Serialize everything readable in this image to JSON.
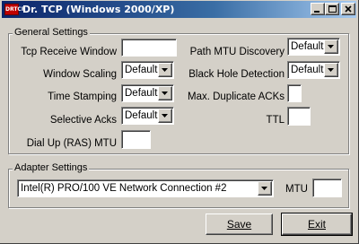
{
  "window": {
    "title": "Dr. TCP (Windows 2000/XP)",
    "app_icon_text": "DRTCP",
    "colors": {
      "titlebar": "#0a246a",
      "face": "#d4d0c8"
    }
  },
  "general": {
    "group_label": "General Settings",
    "tcp_receive_window": {
      "label": "Tcp Receive Window",
      "value": ""
    },
    "window_scaling": {
      "label": "Window Scaling",
      "value": "Default"
    },
    "time_stamping": {
      "label": "Time Stamping",
      "value": "Default"
    },
    "selective_acks": {
      "label": "Selective Acks",
      "value": "Default"
    },
    "dial_up_mtu": {
      "label": "Dial Up (RAS) MTU",
      "value": ""
    },
    "path_mtu_discovery": {
      "label": "Path MTU Discovery",
      "value": "Default"
    },
    "black_hole_detection": {
      "label": "Black Hole Detection",
      "value": "Default"
    },
    "max_duplicate_acks": {
      "label": "Max. Duplicate ACKs",
      "value": ""
    },
    "ttl": {
      "label": "TTL",
      "value": ""
    }
  },
  "adapter": {
    "group_label": "Adapter Settings",
    "selected_adapter": "Intel(R) PRO/100 VE Network Connection #2",
    "mtu_label": "MTU",
    "mtu_value": ""
  },
  "buttons": {
    "save": "Save",
    "exit": "Exit"
  }
}
